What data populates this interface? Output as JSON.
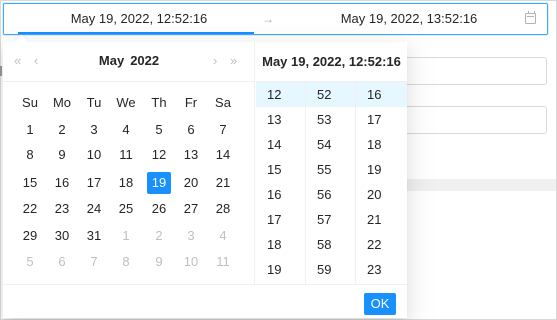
{
  "range": {
    "start": "May 19, 2022, 12:52:16",
    "separator": "→",
    "end": "May 19, 2022, 13:52:16",
    "calendar_icon": "calendar-icon"
  },
  "calendar": {
    "nav": {
      "super_prev": "«",
      "prev": "‹",
      "next": "›",
      "super_next": "»"
    },
    "month": "May",
    "year": "2022",
    "weekdays": [
      "Su",
      "Mo",
      "Tu",
      "We",
      "Th",
      "Fr",
      "Sa"
    ],
    "weeks": [
      [
        {
          "d": "1"
        },
        {
          "d": "2"
        },
        {
          "d": "3"
        },
        {
          "d": "4"
        },
        {
          "d": "5"
        },
        {
          "d": "6"
        },
        {
          "d": "7"
        }
      ],
      [
        {
          "d": "8"
        },
        {
          "d": "9"
        },
        {
          "d": "10"
        },
        {
          "d": "11"
        },
        {
          "d": "12"
        },
        {
          "d": "13"
        },
        {
          "d": "14"
        }
      ],
      [
        {
          "d": "15"
        },
        {
          "d": "16"
        },
        {
          "d": "17"
        },
        {
          "d": "18"
        },
        {
          "d": "19",
          "selected": true
        },
        {
          "d": "20"
        },
        {
          "d": "21"
        }
      ],
      [
        {
          "d": "22"
        },
        {
          "d": "23"
        },
        {
          "d": "24"
        },
        {
          "d": "25"
        },
        {
          "d": "26"
        },
        {
          "d": "27"
        },
        {
          "d": "28"
        }
      ],
      [
        {
          "d": "29"
        },
        {
          "d": "30"
        },
        {
          "d": "31"
        },
        {
          "d": "1",
          "out": true
        },
        {
          "d": "2",
          "out": true
        },
        {
          "d": "3",
          "out": true
        },
        {
          "d": "4",
          "out": true
        }
      ],
      [
        {
          "d": "5",
          "out": true
        },
        {
          "d": "6",
          "out": true
        },
        {
          "d": "7",
          "out": true
        },
        {
          "d": "8",
          "out": true
        },
        {
          "d": "9",
          "out": true
        },
        {
          "d": "10",
          "out": true
        },
        {
          "d": "11",
          "out": true
        }
      ]
    ]
  },
  "time": {
    "header": "May 19, 2022, 12:52:16",
    "hours": [
      "12",
      "13",
      "14",
      "15",
      "16",
      "17",
      "18",
      "19"
    ],
    "minutes": [
      "52",
      "53",
      "54",
      "55",
      "56",
      "57",
      "58",
      "59"
    ],
    "seconds": [
      "16",
      "17",
      "18",
      "19",
      "20",
      "21",
      "22",
      "23"
    ],
    "selected_hour": "12",
    "selected_minute": "52",
    "selected_second": "16"
  },
  "footer": {
    "ok_label": "OK"
  },
  "colors": {
    "accent": "#1890ff",
    "selected_time_bg": "#e6f7ff",
    "muted": "#bfbfbf"
  }
}
